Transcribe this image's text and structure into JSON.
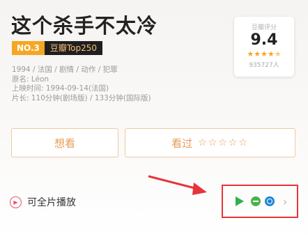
{
  "movie": {
    "title": "这个杀手不太冷",
    "rank_badge": "NO.3",
    "list_badge": "豆瓣Top250",
    "meta": [
      "1994 / 法国 / 剧情 / 动作 / 犯罪",
      "原名: Léon",
      "上映时间: 1994-09-14(法国)",
      "片长: 110分钟(剧场版) / 133分钟(国际版)"
    ]
  },
  "rating": {
    "label": "豆瓣评分",
    "score": "9.4",
    "stars_filled": 4.5,
    "count": "935727人"
  },
  "actions": {
    "want_label": "想看",
    "seen_label": "看过",
    "rate_stars": "☆☆☆☆☆"
  },
  "play": {
    "label": "可全片播放"
  },
  "platforms": {
    "icons": [
      "tencent-video-icon",
      "iqiyi-icon",
      "youku-icon"
    ],
    "chevron": "›"
  },
  "colors": {
    "accent_orange": "#f5a623",
    "button_text": "#e89a55",
    "highlight_red": "#e8333a"
  }
}
